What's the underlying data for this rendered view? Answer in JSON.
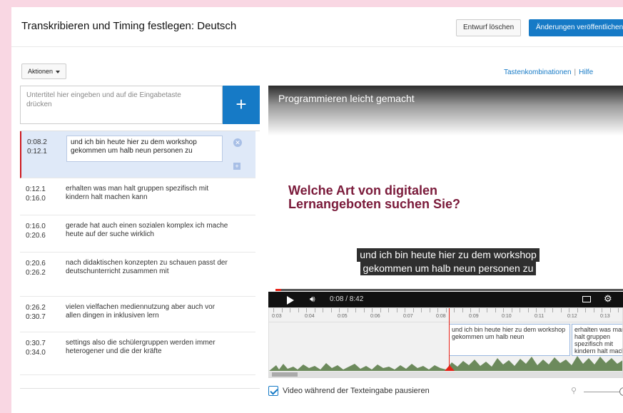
{
  "header": {
    "title": "Transkribieren und Timing festlegen: Deutsch",
    "draft_button": "Entwurf löschen",
    "publish_button": "Änderungen veröffentlichen"
  },
  "toolbar": {
    "actions_label": "Aktionen",
    "shortcuts_link": "Tastenkombinationen",
    "separator": "|",
    "help_link": "Hilfe"
  },
  "editor": {
    "input_placeholder": "Untertitel hier eingeben und auf die Eingabetaste drücken",
    "add_symbol": "+"
  },
  "subtitles": [
    {
      "start": "0:08.2",
      "end": "0:12.1",
      "text": "und ich bin heute hier zu dem workshop gekommen um halb neun personen zu",
      "active": true
    },
    {
      "start": "0:12.1",
      "end": "0:16.0",
      "text": "erhalten was man halt gruppen spezifisch mit kindern halt machen kann"
    },
    {
      "start": "0:16.0",
      "end": "0:20.6",
      "text": "gerade hat auch einen sozialen komplex ich mache heute auf der suche wirklich"
    },
    {
      "start": "0:20.6",
      "end": "0:26.2",
      "text": "nach didaktischen konzepten zu schauen passt der deutschunterricht zusammen mit"
    },
    {
      "start": "0:26.2",
      "end": "0:30.7",
      "text": "vielen vielfachen mediennutzung aber auch vor allen dingen in inklusiven lern"
    },
    {
      "start": "0:30.7",
      "end": "0:34.0",
      "text": "settings also die schülergruppen werden immer heterogener und die der kräfte"
    }
  ],
  "video": {
    "title": "Programmieren leicht gemacht",
    "slide_text": "Welche Art von digitalen Lernangeboten suchen Sie?",
    "caption_line1": "und ich bin heute hier zu dem workshop",
    "caption_line2": "gekommen um halb neun personen zu",
    "time": "0:08 / 8:42",
    "progress": 0.016
  },
  "timeline": {
    "ticks": [
      "0:03",
      "0:04",
      "0:05",
      "0:06",
      "0:07",
      "0:08",
      "0:09",
      "0:10",
      "0:11",
      "0:12",
      "0:13"
    ],
    "cue1": "und ich bin heute hier zu dem workshop gekommen um halb neun",
    "cue2": "erhalten was man halt gruppen spezifisch mit kindern halt machen"
  },
  "footer": {
    "pause_label": "Video während der Texteingabe pausieren",
    "pause_checked": true
  },
  "colors": {
    "accent": "#167ac6",
    "active_marker": "#cc181e",
    "slide_text": "#7a1a3a"
  }
}
